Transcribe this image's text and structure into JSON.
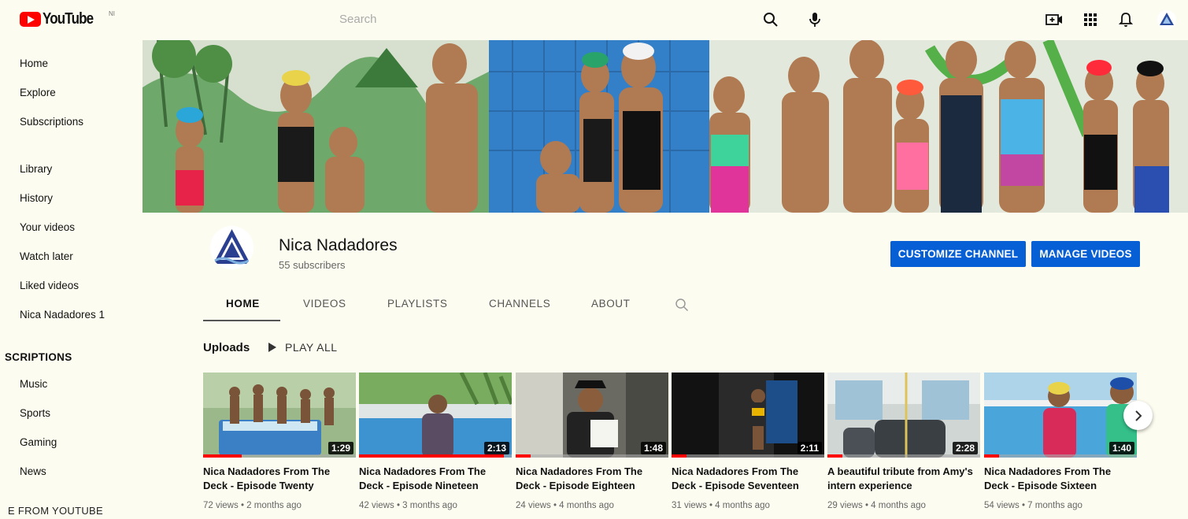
{
  "header": {
    "logo_text": "YouTube",
    "country_code": "NI",
    "search_placeholder": "Search",
    "icons": [
      "search-icon",
      "microphone-icon",
      "create-video-icon",
      "apps-grid-icon",
      "notifications-bell-icon",
      "account-avatar-icon"
    ]
  },
  "sidebar": {
    "main": [
      {
        "label": "Home"
      },
      {
        "label": "Explore"
      },
      {
        "label": "Subscriptions"
      }
    ],
    "library": [
      {
        "label": "Library"
      },
      {
        "label": "History"
      },
      {
        "label": "Your videos"
      },
      {
        "label": "Watch later"
      },
      {
        "label": "Liked videos"
      },
      {
        "label": "Nica Nadadores 1"
      }
    ],
    "subscriptions_header": "SCRIPTIONS",
    "subscriptions": [
      {
        "label": "Music"
      },
      {
        "label": "Sports"
      },
      {
        "label": "Gaming"
      },
      {
        "label": "News"
      }
    ],
    "more_header": "E FROM YOUTUBE"
  },
  "channel": {
    "name": "Nica Nadadores",
    "subscribers": "55 subscribers",
    "customize_label": "CUSTOMIZE CHANNEL",
    "manage_label": "MANAGE VIDEOS",
    "accent_color": "#065fd4"
  },
  "tabs": [
    {
      "label": "HOME",
      "active": true
    },
    {
      "label": "VIDEOS"
    },
    {
      "label": "PLAYLISTS"
    },
    {
      "label": "CHANNELS"
    },
    {
      "label": "ABOUT"
    }
  ],
  "uploads": {
    "title": "Uploads",
    "play_all": "PLAY ALL",
    "videos": [
      {
        "title": "Nica Nadadores From The Deck - Episode Twenty",
        "duration": "1:29",
        "views": "72 views",
        "age": "2 months ago",
        "watched_fraction": 0.25
      },
      {
        "title": "Nica Nadadores From The Deck - Episode Nineteen",
        "duration": "2:13",
        "views": "42 views",
        "age": "3 months ago",
        "watched_fraction": 0.95
      },
      {
        "title": "Nica Nadadores From The Deck - Episode Eighteen",
        "duration": "1:48",
        "views": "24 views",
        "age": "4 months ago",
        "watched_fraction": 0.1
      },
      {
        "title": "Nica Nadadores From The Deck - Episode Seventeen",
        "duration": "2:11",
        "views": "31 views",
        "age": "4 months ago",
        "watched_fraction": 0.1
      },
      {
        "title": "A beautiful tribute from Amy's intern experience",
        "duration": "2:28",
        "views": "29 views",
        "age": "4 months ago",
        "watched_fraction": 0.1
      },
      {
        "title": "Nica Nadadores From The Deck - Episode Sixteen",
        "duration": "1:40",
        "views": "54 views",
        "age": "7 months ago",
        "watched_fraction": 0.1
      }
    ]
  }
}
